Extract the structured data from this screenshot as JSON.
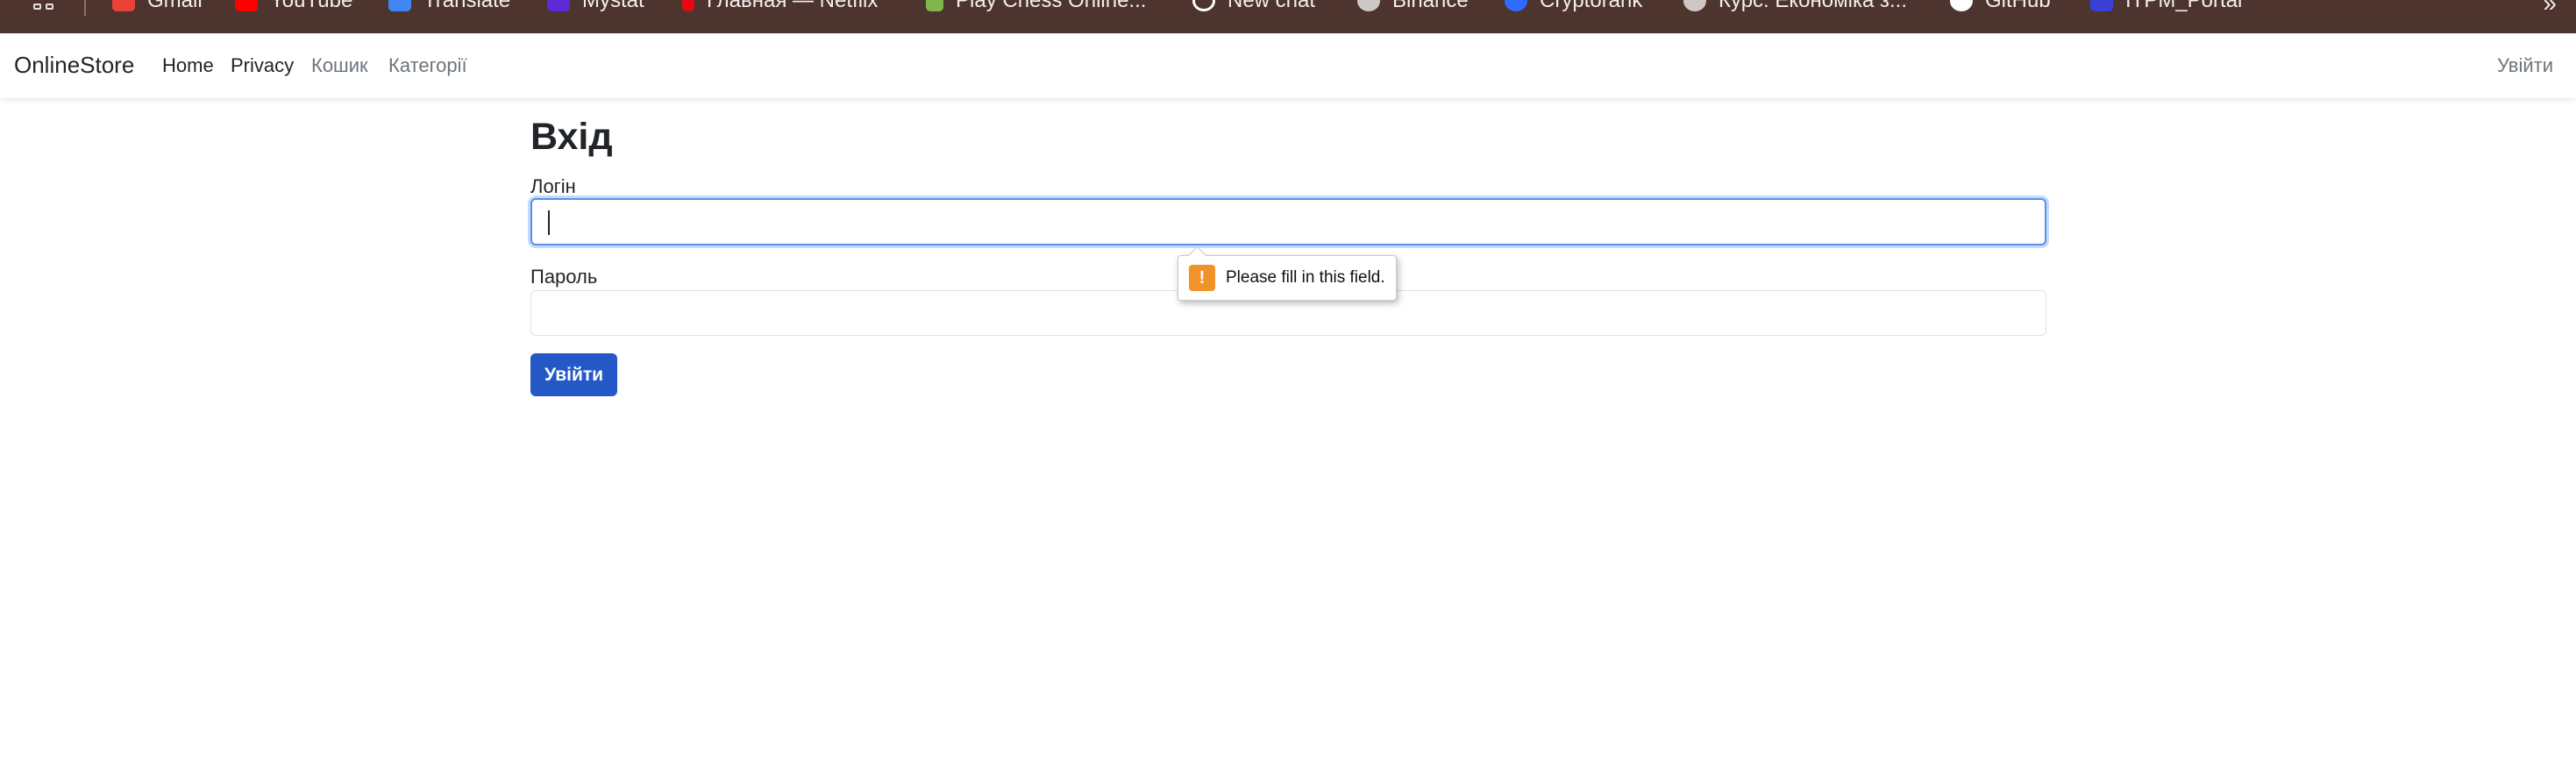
{
  "bookmarks": [
    {
      "label": "Gmail",
      "icon": "gmail-icon",
      "color": "#ea4335"
    },
    {
      "label": "YouTube",
      "icon": "youtube-icon",
      "color": "#ff0000"
    },
    {
      "label": "Translate",
      "icon": "translate-icon",
      "color": "#4285f4"
    },
    {
      "label": "Mystat",
      "icon": "mystat-icon",
      "color": "#5b2bd6"
    },
    {
      "label": "Главная — Netflix",
      "icon": "netflix-icon",
      "color": "#e50914"
    },
    {
      "label": "Play Chess Online...",
      "icon": "chess-pawn-icon",
      "color": "#81b64c"
    },
    {
      "label": "New chat",
      "icon": "chatgpt-icon",
      "color": "#ffffff"
    },
    {
      "label": "Binance",
      "icon": "globe-icon",
      "color": "#cfc7c4"
    },
    {
      "label": "Cryptorank",
      "icon": "cryptorank-icon",
      "color": "#2f6bff"
    },
    {
      "label": "Курс: Економіка з...",
      "icon": "globe-icon",
      "color": "#cfc7c4"
    },
    {
      "label": "GitHub",
      "icon": "github-icon",
      "color": "#ffffff"
    },
    {
      "label": "ITPM_Portal",
      "icon": "portal-icon",
      "color": "#3a3fd6"
    }
  ],
  "navbar": {
    "brand": "OnlineStore",
    "links": [
      "Home",
      "Privacy",
      "Кошик",
      "Категорії"
    ],
    "login_link": "Увійти"
  },
  "form": {
    "title": "Вхід",
    "login_label": "Логін",
    "login_value": "",
    "password_label": "Пароль",
    "password_value": "",
    "submit_label": "Увійти"
  },
  "tooltip": {
    "text": "Please fill in this field."
  },
  "colors": {
    "bookmark_bar": "#4d342e",
    "primary_button": "#2458c7",
    "focus_ring": "#5b8fe8",
    "warning": "#f0932b"
  }
}
